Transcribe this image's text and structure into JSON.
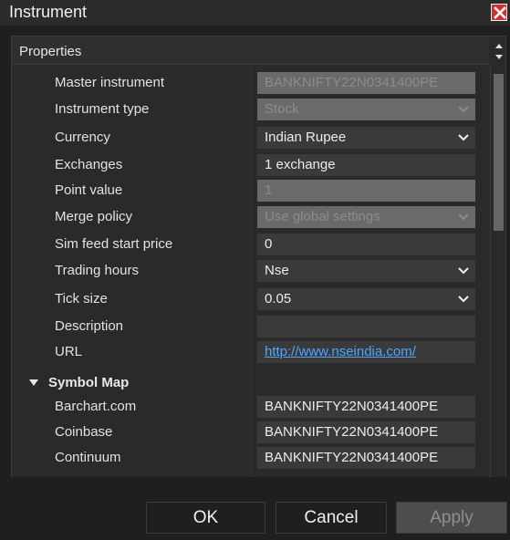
{
  "window": {
    "title": "Instrument",
    "close_icon": "close-icon",
    "close_color": "#d32f2f"
  },
  "panel": {
    "title": "Properties"
  },
  "properties": [
    {
      "label": "Master instrument",
      "value": "BANKNIFTY22N0341400PE",
      "disabled": true,
      "dropdown": false
    },
    {
      "label": "Instrument type",
      "value": "Stock",
      "disabled": true,
      "dropdown": true
    },
    {
      "label": "Currency",
      "value": "Indian Rupee",
      "disabled": false,
      "dropdown": true
    },
    {
      "label": "Exchanges",
      "value": "1 exchange",
      "disabled": false,
      "dropdown": false
    },
    {
      "label": "Point value",
      "value": "1",
      "disabled": true,
      "dropdown": false
    },
    {
      "label": "Merge policy",
      "value": "Use global settings",
      "disabled": true,
      "dropdown": true
    },
    {
      "label": "Sim feed start price",
      "value": "0",
      "disabled": false,
      "dropdown": false
    },
    {
      "label": "Trading hours",
      "value": "Nse",
      "disabled": false,
      "dropdown": true
    },
    {
      "label": "Tick size",
      "value": "0.05",
      "disabled": false,
      "dropdown": true
    },
    {
      "label": "Description",
      "value": "",
      "disabled": false,
      "dropdown": false
    },
    {
      "label": "URL",
      "value": "http://www.nseindia.com/",
      "disabled": false,
      "dropdown": false,
      "link": true
    }
  ],
  "symbol_map": {
    "title": "Symbol Map",
    "items": [
      {
        "label": "Barchart.com",
        "value": "BANKNIFTY22N0341400PE"
      },
      {
        "label": "Coinbase",
        "value": "BANKNIFTY22N0341400PE"
      },
      {
        "label": "Continuum",
        "value": "BANKNIFTY22N0341400PE"
      }
    ]
  },
  "buttons": {
    "ok": "OK",
    "cancel": "Cancel",
    "apply": "Apply"
  },
  "colors": {
    "link": "#4da6ff",
    "disabled_field": "#6a6a6a",
    "field": "#3a3a3a"
  }
}
